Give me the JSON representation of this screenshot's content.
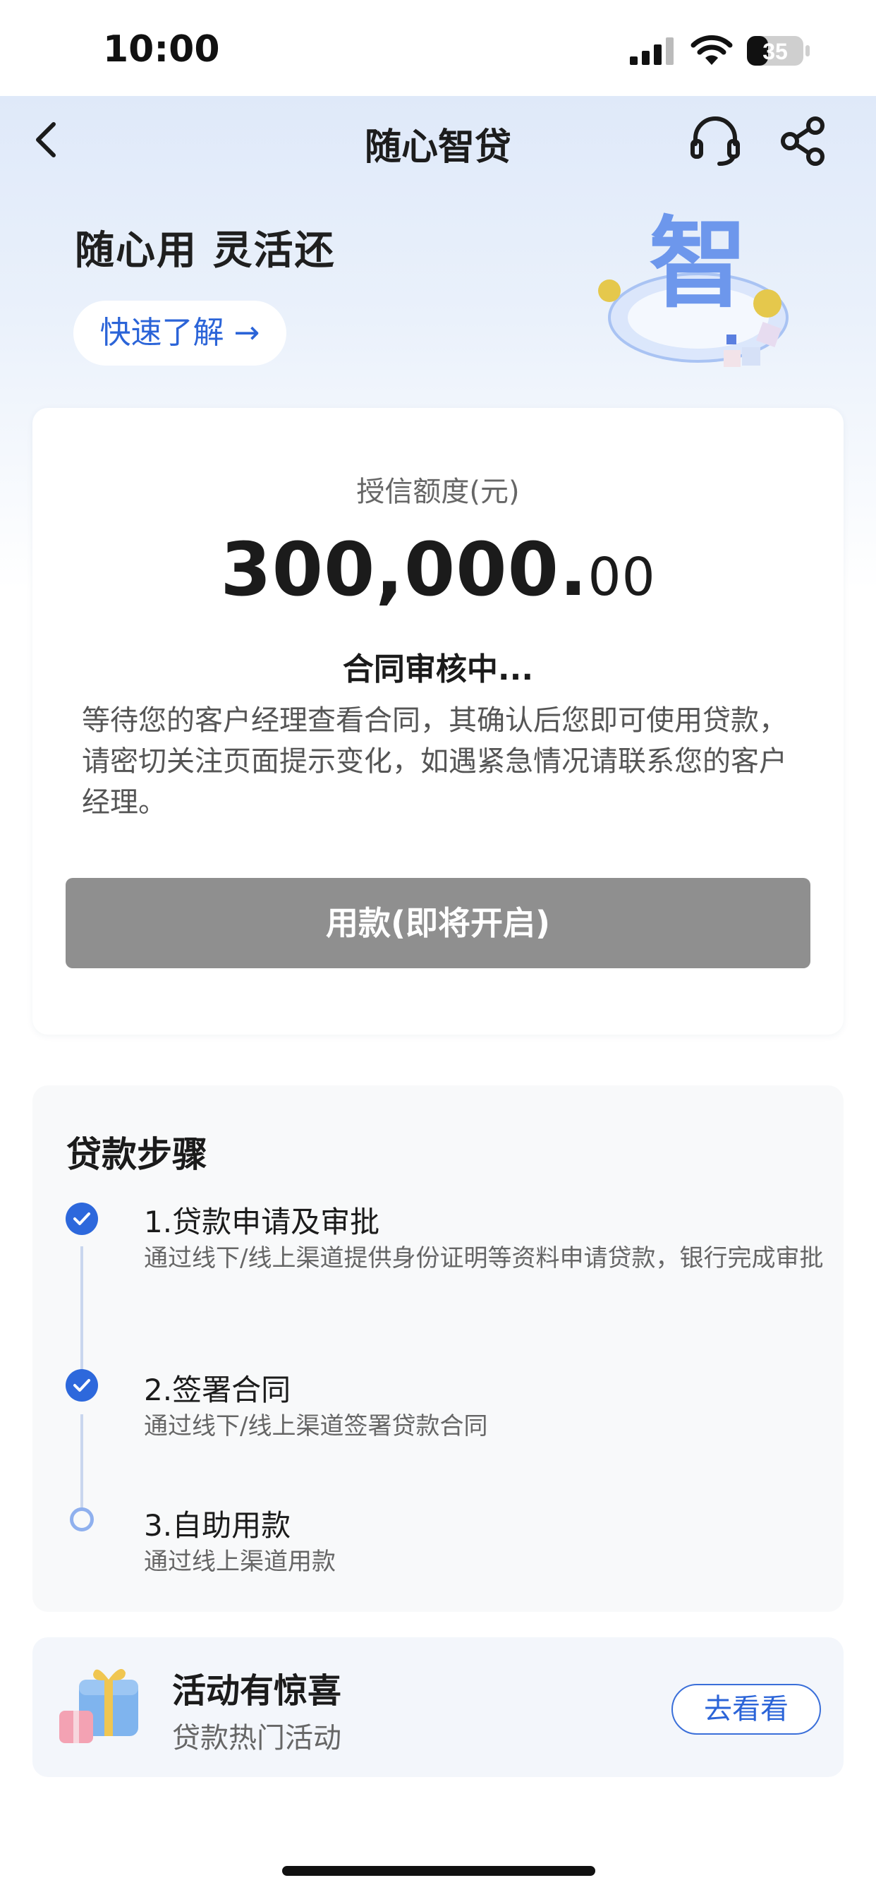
{
  "status_bar": {
    "time": "10:00",
    "battery": "35"
  },
  "nav": {
    "title": "随心智贷",
    "back_icon": "chevron-left-icon",
    "support_icon": "headset-icon",
    "share_icon": "share-icon"
  },
  "hero": {
    "slogan": "随心用 灵活还",
    "learn_more": "快速了解 →",
    "art_glyph": "智"
  },
  "quota": {
    "label": "授信额度(元)",
    "amount_integer": "300,000.",
    "amount_decimal": "00",
    "status_title": "合同审核中...",
    "status_desc": "等待您的客户经理查看合同，其确认后您即可使用贷款，请密切关注页面提示变化，如遇紧急情况请联系您的客户经理。",
    "button_label": "用款(即将开启)"
  },
  "steps": {
    "title": "贷款步骤",
    "items": [
      {
        "name": "1.贷款申请及审批",
        "desc": "通过线下/线上渠道提供身份证明等资料申请贷款，银行完成审批",
        "status": "done"
      },
      {
        "name": "2.签署合同",
        "desc": "通过线下/线上渠道签署贷款合同",
        "status": "done"
      },
      {
        "name": "3.自助用款",
        "desc": "通过线上渠道用款",
        "status": "pending"
      }
    ]
  },
  "promo": {
    "title": "活动有惊喜",
    "subtitle": "贷款热门活动",
    "button_label": "去看看",
    "icon": "gift-icon"
  },
  "colors": {
    "accent": "#2d68dc",
    "disabled_button": "#8f8f8f",
    "hero_gradient_top": "#dfe9f9"
  }
}
